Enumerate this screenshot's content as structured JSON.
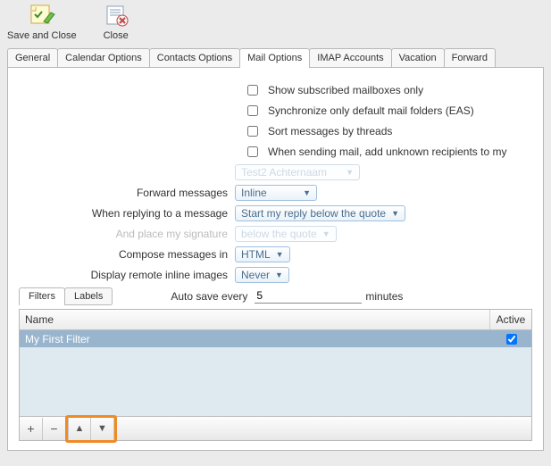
{
  "toolbar": {
    "save_close": "Save and Close",
    "close": "Close"
  },
  "tabs": [
    "General",
    "Calendar Options",
    "Contacts Options",
    "Mail Options",
    "IMAP Accounts",
    "Vacation",
    "Forward"
  ],
  "active_tab_index": 3,
  "checkboxes": {
    "show_subscribed": "Show subscribed mailboxes only",
    "sync_default": "Synchronize only default mail folders (EAS)",
    "sort_threads": "Sort messages by threads",
    "add_unknown": "When sending mail, add unknown recipients to my"
  },
  "unknown_contacts_select": "Test2 Achternaam",
  "rows": {
    "forward_label": "Forward messages",
    "forward_value": "Inline",
    "reply_label": "When replying to a message",
    "reply_value": "Start my reply below the quote",
    "sig_label": "And place my signature",
    "sig_value": "below the quote",
    "compose_label": "Compose messages in",
    "compose_value": "HTML",
    "remote_label": "Display remote inline images",
    "remote_value": "Never"
  },
  "sub_tabs": [
    "Filters",
    "Labels"
  ],
  "active_subtab_index": 0,
  "autosave": {
    "label": "Auto save every",
    "value": "5",
    "suffix": "minutes"
  },
  "table": {
    "col_name": "Name",
    "col_active": "Active",
    "rows": [
      {
        "name": "My First Filter",
        "active": true
      }
    ]
  },
  "footer_buttons": {
    "plus": "+",
    "minus": "−",
    "up": "▲",
    "down": "▼"
  }
}
